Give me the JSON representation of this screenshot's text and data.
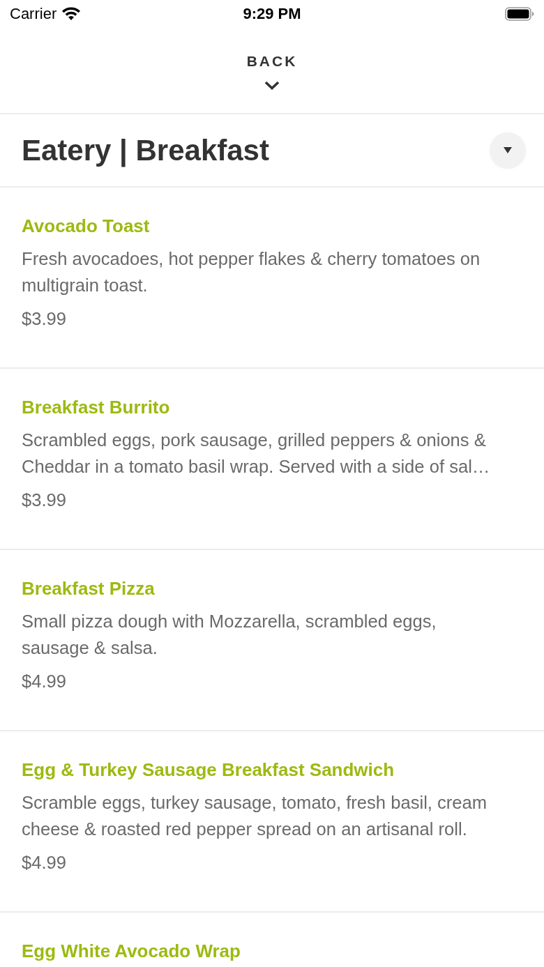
{
  "status_bar": {
    "carrier": "Carrier",
    "time": "9:29 PM"
  },
  "nav": {
    "back_label": "BACK"
  },
  "header": {
    "title": "Eatery | Breakfast"
  },
  "menu_items": [
    {
      "name": "Avocado Toast",
      "description": "Fresh avocadoes, hot pepper flakes & cherry tomatoes on multigrain toast.",
      "price": "$3.99"
    },
    {
      "name": "Breakfast Burrito",
      "description": "Scrambled eggs, pork sausage, grilled peppers & onions & Cheddar in a tomato basil wrap. Served with a side of sal…",
      "price": "$3.99"
    },
    {
      "name": "Breakfast Pizza",
      "description": "Small pizza dough with Mozzarella, scrambled eggs, sausage & salsa.",
      "price": "$4.99"
    },
    {
      "name": "Egg & Turkey Sausage Breakfast Sandwich",
      "description": "Scramble eggs, turkey sausage, tomato, fresh basil, cream cheese & roasted red pepper spread on an artisanal roll.",
      "price": "$4.99"
    },
    {
      "name": "Egg White Avocado Wrap"
    }
  ]
}
